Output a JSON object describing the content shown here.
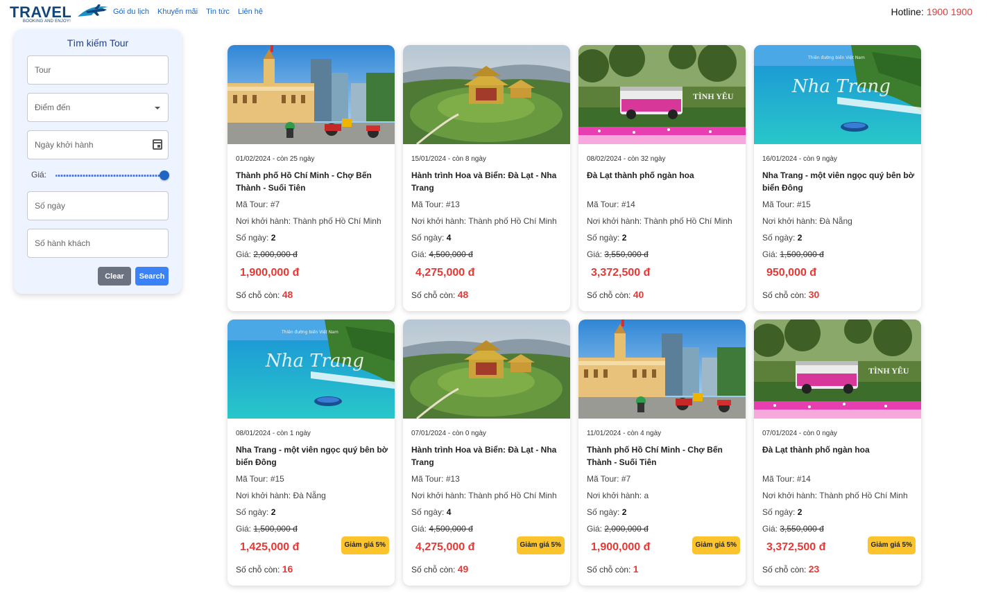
{
  "header": {
    "logo_text": "TRAVEL",
    "logo_tagline": "BOOKING AND ENJOY!",
    "nav": [
      "Gói du lịch",
      "Khuyến mãi",
      "Tin tức",
      "Liên hệ"
    ],
    "hotline_label": "Hotline:",
    "hotline_number": "1900 1900"
  },
  "search": {
    "title": "Tìm kiếm Tour",
    "tour_placeholder": "Tour",
    "destination_placeholder": "Điểm đến",
    "date_placeholder": "Ngày khởi hành",
    "price_label": "Giá:",
    "price_slider_value": 1.0,
    "days_placeholder": "Số ngày",
    "guests_placeholder": "Số hành khách",
    "clear_label": "Clear",
    "search_label": "Search"
  },
  "labels": {
    "code": "Mã Tour:",
    "start": "Nơi khởi hành:",
    "days": "Số ngày:",
    "price": "Giá:",
    "seats": "Số chỗ còn:"
  },
  "tours": [
    {
      "date": "01/02/2024",
      "remain": "còn 25 ngày",
      "title": "Thành phố Hồ Chí Minh - Chợ Bến Thành - Suối Tiên",
      "code": "#7",
      "start": "Thành phố Hồ Chí Minh",
      "days": "2",
      "old_price": "2,000,000 đ",
      "new_price": "1,900,000 đ",
      "discount": "",
      "seats": "48",
      "scene": "hcm"
    },
    {
      "date": "15/01/2024",
      "remain": "còn 8 ngày",
      "title": "Hành trình Hoa và Biển: Đà Lạt - Nha Trang",
      "code": "#13",
      "start": "Thành phố Hồ Chí Minh",
      "days": "4",
      "old_price": "4,500,000 đ",
      "new_price": "4,275,000 đ",
      "discount": "",
      "seats": "48",
      "scene": "pagoda"
    },
    {
      "date": "08/02/2024",
      "remain": "còn 32 ngày",
      "title": "Đà Lạt thành phố ngàn hoa",
      "code": "#14",
      "start": "Thành phố Hồ Chí Minh",
      "days": "2",
      "old_price": "3,550,000 đ",
      "new_price": "3,372,500 đ",
      "discount": "",
      "seats": "40",
      "scene": "dalat"
    },
    {
      "date": "16/01/2024",
      "remain": "còn 9 ngày",
      "title": "Nha Trang - một viên ngọc quý bên bờ biển Đông",
      "code": "#15",
      "start": "Đà Nẵng",
      "days": "2",
      "old_price": "1,500,000 đ",
      "new_price": "950,000 đ",
      "discount": "",
      "seats": "30",
      "scene": "beach"
    },
    {
      "date": "08/01/2024",
      "remain": "còn 1 ngày",
      "title": "Nha Trang - một viên ngọc quý bên bờ biển Đông",
      "code": "#15",
      "start": "Đà Nẵng",
      "days": "2",
      "old_price": "1,500,000 đ",
      "new_price": "1,425,000 đ",
      "discount": "Giảm giá 5%",
      "seats": "16",
      "scene": "beach"
    },
    {
      "date": "07/01/2024",
      "remain": "còn 0 ngày",
      "title": "Hành trình Hoa và Biển: Đà Lạt - Nha Trang",
      "code": "#13",
      "start": "Thành phố Hồ Chí Minh",
      "days": "4",
      "old_price": "4,500,000 đ",
      "new_price": "4,275,000 đ",
      "discount": "Giảm giá 5%",
      "seats": "49",
      "scene": "pagoda"
    },
    {
      "date": "11/01/2024",
      "remain": "còn 4 ngày",
      "title": "Thành phố Hồ Chí Minh - Chợ Bến Thành - Suối Tiên",
      "code": "#7",
      "start": "a",
      "days": "2",
      "old_price": "2,000,000 đ",
      "new_price": "1,900,000 đ",
      "discount": "Giảm giá 5%",
      "seats": "1",
      "scene": "hcm"
    },
    {
      "date": "07/01/2024",
      "remain": "còn 0 ngày",
      "title": "Đà Lạt thành phố ngàn hoa",
      "code": "#14",
      "start": "Thành phố Hồ Chí Minh",
      "days": "2",
      "old_price": "3,550,000 đ",
      "new_price": "3,372,500 đ",
      "discount": "Giảm giá 5%",
      "seats": "23",
      "scene": "dalat"
    }
  ],
  "image_captions": {
    "dalat_sign": "TÌNH YÊU",
    "beach_script": "Nha Trang",
    "beach_tagline": "Thiên đường biển Việt Nam"
  },
  "colors": {
    "primary": "#1f66c2",
    "accent_red": "#e53935",
    "discount_badge": "#fbc42d",
    "sidebar_bg": "#eef4ff"
  }
}
